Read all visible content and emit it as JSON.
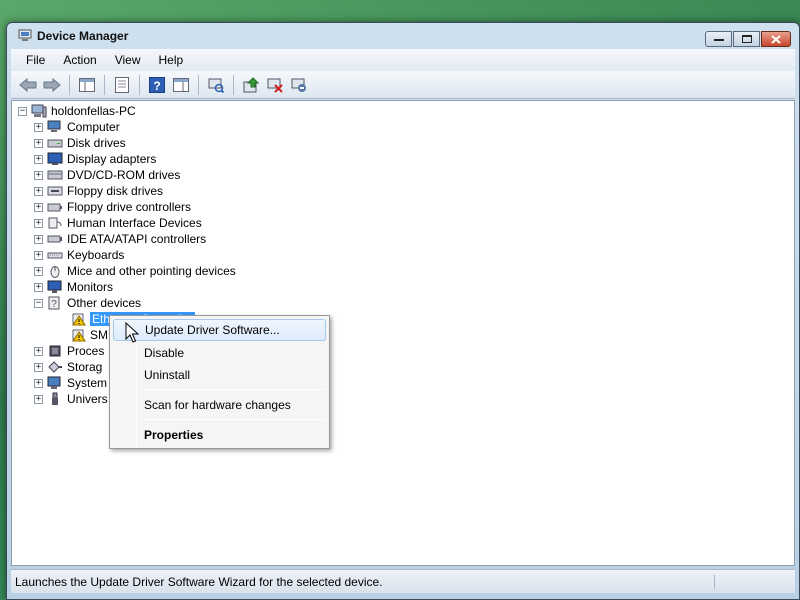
{
  "window": {
    "title": "Device Manager"
  },
  "menubar": {
    "items": [
      "File",
      "Action",
      "View",
      "Help"
    ]
  },
  "toolbar": {
    "buttons": [
      "back-icon",
      "forward-icon",
      "show-hide-console-tree-icon",
      "properties-icon",
      "help-icon",
      "action-pane-icon",
      "scan-hardware-icon",
      "update-driver-icon",
      "disable-device-icon",
      "uninstall-device-icon"
    ]
  },
  "tree": {
    "root": "holdonfellas-PC",
    "categories": [
      {
        "label": "Computer"
      },
      {
        "label": "Disk drives"
      },
      {
        "label": "Display adapters"
      },
      {
        "label": "DVD/CD-ROM drives"
      },
      {
        "label": "Floppy disk drives"
      },
      {
        "label": "Floppy drive controllers"
      },
      {
        "label": "Human Interface Devices"
      },
      {
        "label": "IDE ATA/ATAPI controllers"
      },
      {
        "label": "Keyboards"
      },
      {
        "label": "Mice and other pointing devices"
      },
      {
        "label": "Monitors"
      },
      {
        "label": "Other devices"
      }
    ],
    "other_devices_children": [
      {
        "label": "Ethernet Controller"
      },
      {
        "label": "SM"
      }
    ],
    "categories_after": [
      {
        "label": "Proces"
      },
      {
        "label": "Storag"
      },
      {
        "label": "System"
      },
      {
        "label": "Univers"
      }
    ]
  },
  "context_menu": {
    "items": [
      {
        "label": "Update Driver Software..."
      },
      {
        "label": "Disable"
      },
      {
        "label": "Uninstall"
      },
      {
        "label": "Scan for hardware changes"
      },
      {
        "label": "Properties"
      }
    ]
  },
  "statusbar": {
    "text": "Launches the Update Driver Software Wizard for the selected device."
  },
  "colors": {
    "selection": "#3399ff",
    "menu_hover": "#dcebfc",
    "desktop": "#3c9a62"
  }
}
